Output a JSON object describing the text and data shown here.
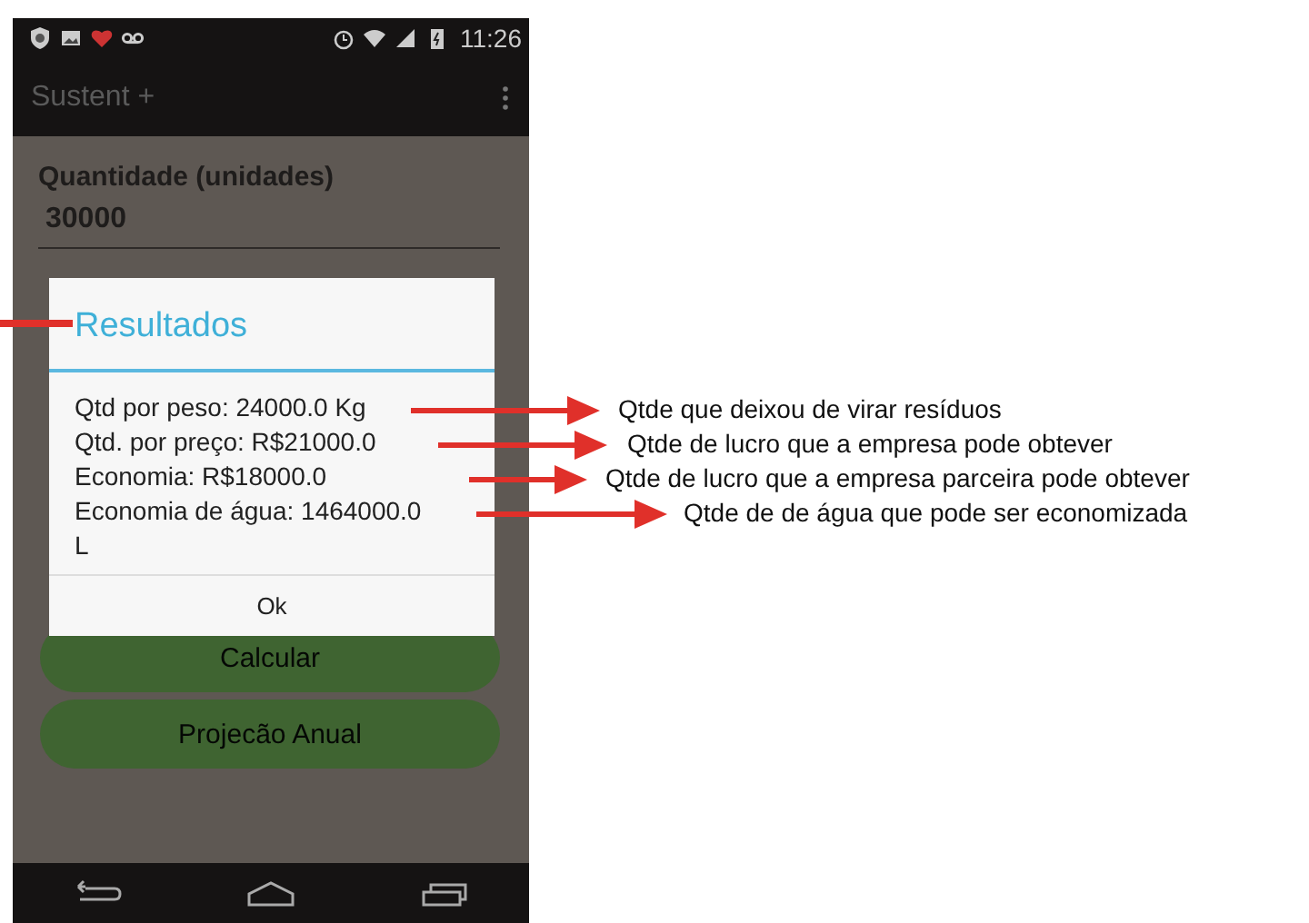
{
  "status_bar": {
    "time": "11:26"
  },
  "app_bar": {
    "title": "Sustent +"
  },
  "form": {
    "field": {
      "label": "Quantidade (unidades)",
      "value": "30000"
    },
    "buttons": [
      "Calcular",
      "Projecão Anual"
    ]
  },
  "dialog": {
    "title": "Resultados",
    "lines": [
      "Qtd por peso: 24000.0 Kg",
      "Qtd. por preço: R$21000.0",
      "Economia: R$18000.0",
      "Economia de água: 1464000.0 L"
    ],
    "button": "Ok"
  },
  "annotations": [
    "Qtde que deixou de virar resíduos",
    "Qtde de lucro que a empresa pode obtever",
    "Qtde de lucro que a empresa parceira pode obtever",
    "Qtde de de água que pode ser economizada"
  ]
}
